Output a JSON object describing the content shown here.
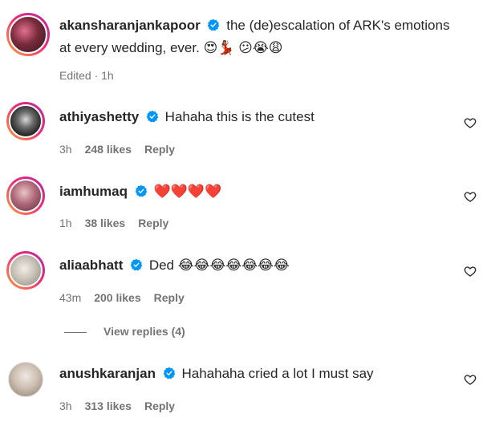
{
  "caption": {
    "username": "akansharanjankapoor",
    "text": "the (de)escalation of ARK's emotions at every wedding, ever.",
    "emojis": "😍💃🏽 😕😭😩",
    "edited": "Edited · 1h"
  },
  "comments": [
    {
      "username": "athiyashetty",
      "text": "Hahaha this is the cutest",
      "time": "3h",
      "likes": "248 likes",
      "reply": "Reply"
    },
    {
      "username": "iamhumaq",
      "text": "❤️❤️❤️❤️",
      "time": "1h",
      "likes": "38 likes",
      "reply": "Reply"
    },
    {
      "username": "aliaabhatt",
      "text": "Ded 😂😂😂😂😂😂😂",
      "time": "43m",
      "likes": "200 likes",
      "reply": "Reply"
    },
    {
      "username": "anushkaranjan",
      "text": "Hahahaha cried a lot I must say",
      "time": "3h",
      "likes": "313 likes",
      "reply": "Reply"
    }
  ],
  "view_replies": "View replies (4)",
  "colors": {
    "verified": "#0095f6",
    "secondary_text": "#737373",
    "primary_text": "#262626"
  }
}
